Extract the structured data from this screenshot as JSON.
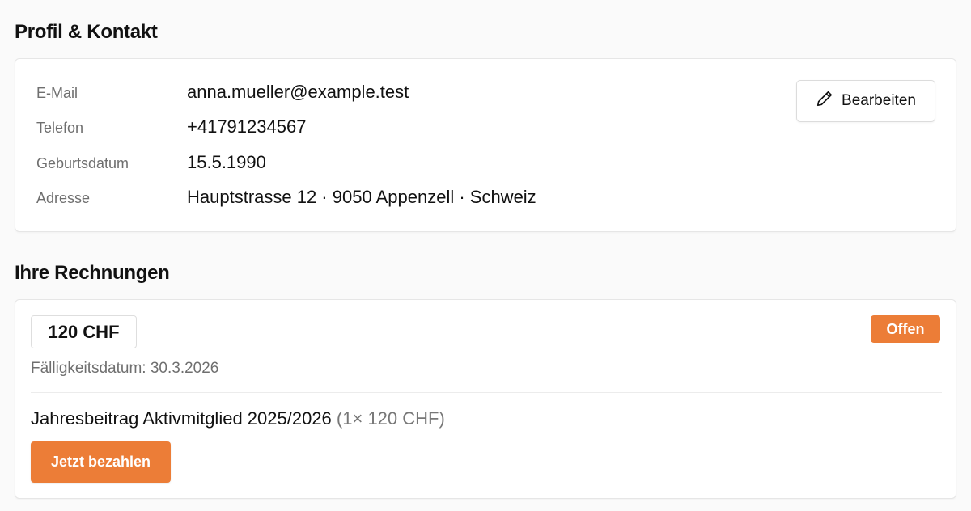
{
  "profile": {
    "title": "Profil & Kontakt",
    "edit_label": "Bearbeiten",
    "fields": [
      {
        "label": "E-Mail",
        "value": "anna.mueller@example.test"
      },
      {
        "label": "Telefon",
        "value": "+41791234567"
      },
      {
        "label": "Geburtsdatum",
        "value": "15.5.1990"
      },
      {
        "label": "Adresse",
        "value": "Hauptstrasse 12 · 9050 Appenzell · Schweiz"
      }
    ]
  },
  "invoices": {
    "title": "Ihre Rechnungen",
    "items": [
      {
        "amount": "120 CHF",
        "status": "Offen",
        "due_date": "Fälligkeitsdatum: 30.3.2026",
        "description": "Jahresbeitrag Aktivmitglied 2025/2026",
        "quantity_text": "(1× 120 CHF)",
        "pay_label": "Jetzt bezahlen"
      }
    ]
  },
  "colors": {
    "accent": "#ec7d37",
    "muted_text": "#6f6f6f",
    "background": "#fafafa"
  },
  "icons": {
    "edit": "pencil-icon"
  }
}
